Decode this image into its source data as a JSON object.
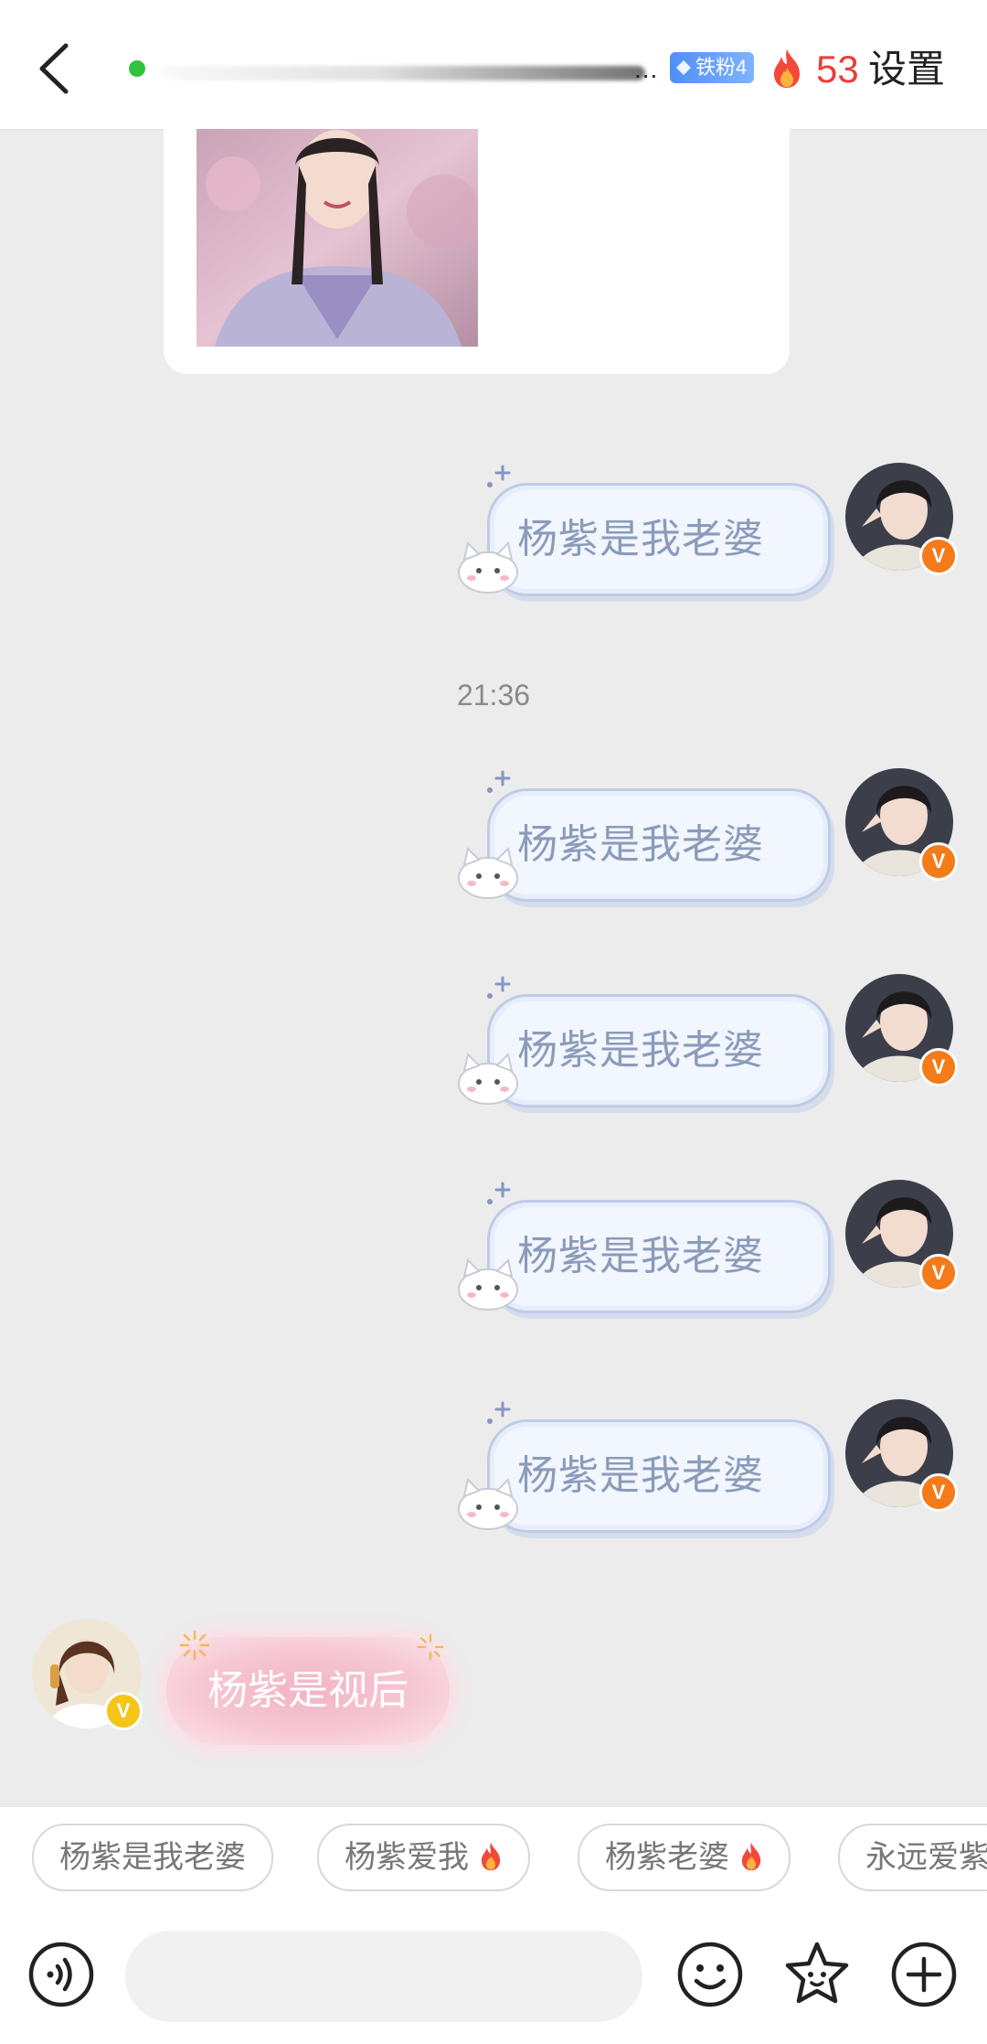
{
  "header": {
    "fan_badge": "铁粉4",
    "streak_count": "53",
    "settings_label": "设置",
    "ellipsis": "..."
  },
  "messages": {
    "outgoing": [
      {
        "text": "杨紫是我老婆"
      },
      {
        "text": "杨紫是我老婆"
      },
      {
        "text": "杨紫是我老婆"
      },
      {
        "text": "杨紫是我老婆"
      },
      {
        "text": "杨紫是我老婆"
      }
    ],
    "timestamp": "21:36",
    "incoming": [
      {
        "text": "杨紫是视后"
      }
    ]
  },
  "quick_replies": [
    {
      "label": "杨紫是我老婆"
    },
    {
      "label": "杨紫爱我"
    },
    {
      "label": "杨紫老婆"
    },
    {
      "label": "永远爱紫"
    }
  ],
  "composer": {
    "placeholder": ""
  },
  "colors": {
    "online": "#31c23f",
    "streak": "#e8403a",
    "fan_badge": "#4f8ff7",
    "verified_badge": "#f37b19",
    "incoming_bubble": "#f2b3c4",
    "outgoing_bubble": "#f1f6ff"
  },
  "icons": {
    "back": "chevron-left-icon",
    "fire": "fire-icon",
    "voice": "voice-icon",
    "emoji": "emoji-icon",
    "sticker": "star-face-icon",
    "more": "plus-icon"
  }
}
